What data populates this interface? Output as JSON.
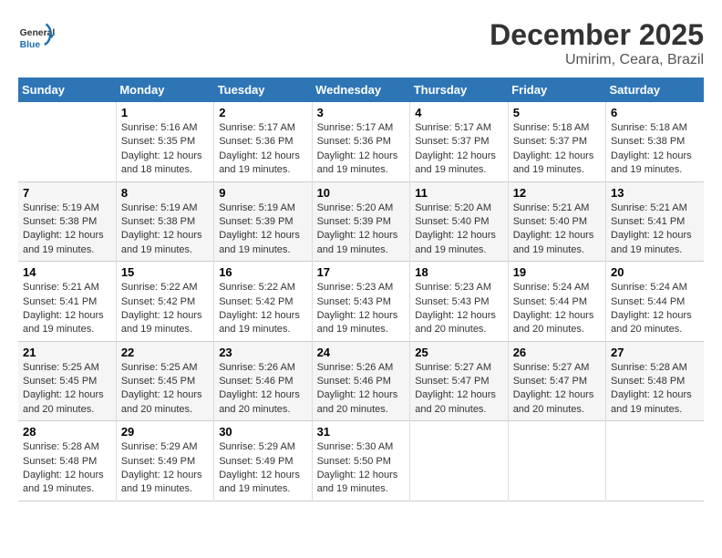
{
  "header": {
    "logo_general": "General",
    "logo_blue": "Blue",
    "month": "December 2025",
    "location": "Umirim, Ceara, Brazil"
  },
  "weekdays": [
    "Sunday",
    "Monday",
    "Tuesday",
    "Wednesday",
    "Thursday",
    "Friday",
    "Saturday"
  ],
  "weeks": [
    [
      {
        "day": "",
        "info": ""
      },
      {
        "day": "1",
        "info": "Sunrise: 5:16 AM\nSunset: 5:35 PM\nDaylight: 12 hours and 18 minutes."
      },
      {
        "day": "2",
        "info": "Sunrise: 5:17 AM\nSunset: 5:36 PM\nDaylight: 12 hours and 19 minutes."
      },
      {
        "day": "3",
        "info": "Sunrise: 5:17 AM\nSunset: 5:36 PM\nDaylight: 12 hours and 19 minutes."
      },
      {
        "day": "4",
        "info": "Sunrise: 5:17 AM\nSunset: 5:37 PM\nDaylight: 12 hours and 19 minutes."
      },
      {
        "day": "5",
        "info": "Sunrise: 5:18 AM\nSunset: 5:37 PM\nDaylight: 12 hours and 19 minutes."
      },
      {
        "day": "6",
        "info": "Sunrise: 5:18 AM\nSunset: 5:38 PM\nDaylight: 12 hours and 19 minutes."
      }
    ],
    [
      {
        "day": "7",
        "info": "Sunrise: 5:19 AM\nSunset: 5:38 PM\nDaylight: 12 hours and 19 minutes."
      },
      {
        "day": "8",
        "info": "Sunrise: 5:19 AM\nSunset: 5:38 PM\nDaylight: 12 hours and 19 minutes."
      },
      {
        "day": "9",
        "info": "Sunrise: 5:19 AM\nSunset: 5:39 PM\nDaylight: 12 hours and 19 minutes."
      },
      {
        "day": "10",
        "info": "Sunrise: 5:20 AM\nSunset: 5:39 PM\nDaylight: 12 hours and 19 minutes."
      },
      {
        "day": "11",
        "info": "Sunrise: 5:20 AM\nSunset: 5:40 PM\nDaylight: 12 hours and 19 minutes."
      },
      {
        "day": "12",
        "info": "Sunrise: 5:21 AM\nSunset: 5:40 PM\nDaylight: 12 hours and 19 minutes."
      },
      {
        "day": "13",
        "info": "Sunrise: 5:21 AM\nSunset: 5:41 PM\nDaylight: 12 hours and 19 minutes."
      }
    ],
    [
      {
        "day": "14",
        "info": "Sunrise: 5:21 AM\nSunset: 5:41 PM\nDaylight: 12 hours and 19 minutes."
      },
      {
        "day": "15",
        "info": "Sunrise: 5:22 AM\nSunset: 5:42 PM\nDaylight: 12 hours and 19 minutes."
      },
      {
        "day": "16",
        "info": "Sunrise: 5:22 AM\nSunset: 5:42 PM\nDaylight: 12 hours and 19 minutes."
      },
      {
        "day": "17",
        "info": "Sunrise: 5:23 AM\nSunset: 5:43 PM\nDaylight: 12 hours and 19 minutes."
      },
      {
        "day": "18",
        "info": "Sunrise: 5:23 AM\nSunset: 5:43 PM\nDaylight: 12 hours and 20 minutes."
      },
      {
        "day": "19",
        "info": "Sunrise: 5:24 AM\nSunset: 5:44 PM\nDaylight: 12 hours and 20 minutes."
      },
      {
        "day": "20",
        "info": "Sunrise: 5:24 AM\nSunset: 5:44 PM\nDaylight: 12 hours and 20 minutes."
      }
    ],
    [
      {
        "day": "21",
        "info": "Sunrise: 5:25 AM\nSunset: 5:45 PM\nDaylight: 12 hours and 20 minutes."
      },
      {
        "day": "22",
        "info": "Sunrise: 5:25 AM\nSunset: 5:45 PM\nDaylight: 12 hours and 20 minutes."
      },
      {
        "day": "23",
        "info": "Sunrise: 5:26 AM\nSunset: 5:46 PM\nDaylight: 12 hours and 20 minutes."
      },
      {
        "day": "24",
        "info": "Sunrise: 5:26 AM\nSunset: 5:46 PM\nDaylight: 12 hours and 20 minutes."
      },
      {
        "day": "25",
        "info": "Sunrise: 5:27 AM\nSunset: 5:47 PM\nDaylight: 12 hours and 20 minutes."
      },
      {
        "day": "26",
        "info": "Sunrise: 5:27 AM\nSunset: 5:47 PM\nDaylight: 12 hours and 20 minutes."
      },
      {
        "day": "27",
        "info": "Sunrise: 5:28 AM\nSunset: 5:48 PM\nDaylight: 12 hours and 19 minutes."
      }
    ],
    [
      {
        "day": "28",
        "info": "Sunrise: 5:28 AM\nSunset: 5:48 PM\nDaylight: 12 hours and 19 minutes."
      },
      {
        "day": "29",
        "info": "Sunrise: 5:29 AM\nSunset: 5:49 PM\nDaylight: 12 hours and 19 minutes."
      },
      {
        "day": "30",
        "info": "Sunrise: 5:29 AM\nSunset: 5:49 PM\nDaylight: 12 hours and 19 minutes."
      },
      {
        "day": "31",
        "info": "Sunrise: 5:30 AM\nSunset: 5:50 PM\nDaylight: 12 hours and 19 minutes."
      },
      {
        "day": "",
        "info": ""
      },
      {
        "day": "",
        "info": ""
      },
      {
        "day": "",
        "info": ""
      }
    ]
  ]
}
